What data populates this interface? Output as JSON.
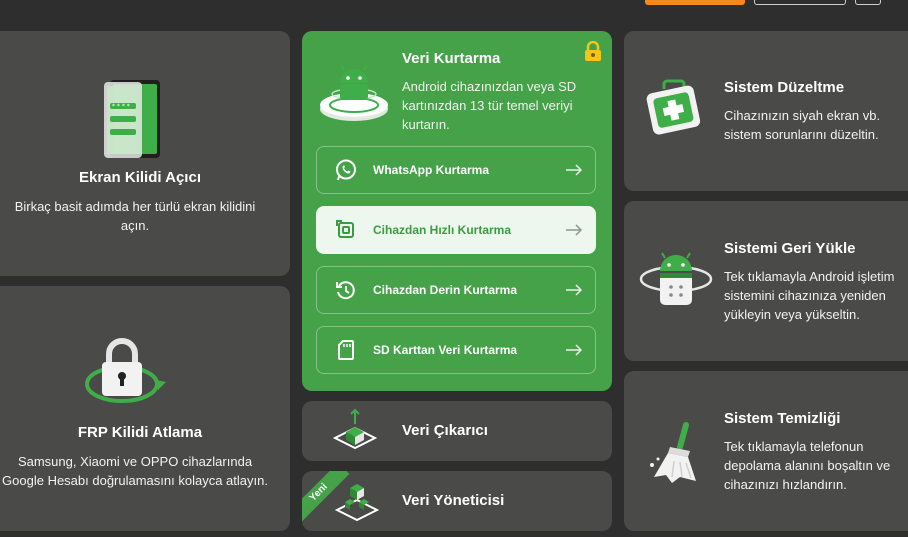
{
  "cards": {
    "ekran": {
      "title": "Ekran Kilidi Açıcı",
      "desc_line1": "Birkaç basit adımda her türlü ekran kilidini",
      "desc_line2": "açın."
    },
    "frp": {
      "title": "FRP Kilidi Atlama",
      "desc_line1": "Samsung, Xiaomi ve OPPO cihazlarında",
      "desc_line2": "Google Hesabı doğrulamasını kolayca atlayın."
    },
    "veri_kurtarma": {
      "title": "Veri Kurtarma",
      "desc_line1": "Android cihazınızdan veya SD",
      "desc_line2": "kartınızdan 13 tür temel veriyi",
      "desc_line3": "kurtarın.",
      "options": [
        {
          "label": "WhatsApp Kurtarma",
          "icon": "whatsapp-icon"
        },
        {
          "label": "Cihazdan Hızlı Kurtarma",
          "icon": "quick-recovery-icon"
        },
        {
          "label": "Cihazdan Derin Kurtarma",
          "icon": "deep-recovery-icon"
        },
        {
          "label": "SD Karttan Veri Kurtarma",
          "icon": "sd-card-icon"
        }
      ]
    },
    "veri_cikarici": {
      "title": "Veri Çıkarıcı"
    },
    "veri_yoneticisi": {
      "title": "Veri Yöneticisi",
      "ribbon": "Yeni"
    },
    "sistem_duzeltme": {
      "title": "Sistem Düzeltme",
      "desc_line1": "Cihazınızın siyah ekran vb.",
      "desc_line2": "sistem sorunlarını düzeltin."
    },
    "sistem_geri_yukle": {
      "title": "Sistemi Geri Yükle",
      "desc_line1": "Tek tıklamayla Android işletim",
      "desc_line2": "sistemini cihazınıza yeniden",
      "desc_line3": "yükleyin veya yükseltin."
    },
    "sistem_temizligi": {
      "title": "Sistem Temizliği",
      "desc_line1": "Tek tıklamayla telefonun",
      "desc_line2": "depolama alanını boşaltın ve",
      "desc_line3": "cihazınızı hızlandırın."
    }
  },
  "colors": {
    "accent_green": "#45a249",
    "card_bg": "#4a4a48",
    "page_bg": "#2e2e2e",
    "orange": "#f28a1c"
  }
}
